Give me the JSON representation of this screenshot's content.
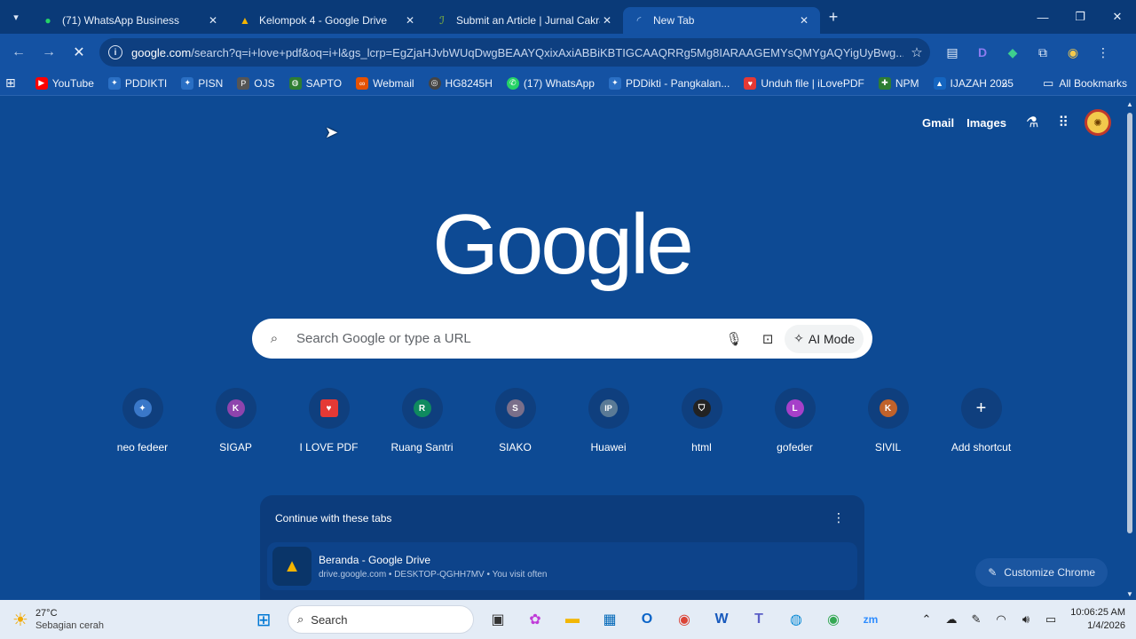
{
  "tabs": [
    {
      "title": "(71) WhatsApp Business",
      "icon": "whatsapp-icon",
      "active": false
    },
    {
      "title": "Kelompok 4 - Google Drive",
      "icon": "google-drive-icon",
      "active": false
    },
    {
      "title": "Submit an Article | Jurnal Cakra",
      "icon": "journal-icon",
      "active": false
    },
    {
      "title": "New Tab",
      "icon": "loading-icon",
      "active": true
    }
  ],
  "omnibox": {
    "url_domain": "google.com",
    "url_rest": "/search?q=i+love+pdf&oq=i+l&gs_lcrp=EgZjaHJvbWUqDwgBEAAYQxixAxiABBiKBTIGCAAQRRg5Mg8IARAAGEMYsQMYgAQYigUyBwg..."
  },
  "bookmarks": [
    {
      "label": "YouTube",
      "color": "#ff0000"
    },
    {
      "label": "PDDIKTI",
      "color": "#2a6fc4"
    },
    {
      "label": "PISN",
      "color": "#2a6fc4"
    },
    {
      "label": "OJS",
      "color": "#555555"
    },
    {
      "label": "SAPTO",
      "color": "#2e7d32"
    },
    {
      "label": "Webmail",
      "color": "#e65100"
    },
    {
      "label": "HG8245H",
      "color": "#444444"
    },
    {
      "label": "(17) WhatsApp",
      "color": "#25d366"
    },
    {
      "label": "PDDikti - Pangkalan...",
      "color": "#2a6fc4"
    },
    {
      "label": "Unduh file | iLovePDF",
      "color": "#e53935"
    },
    {
      "label": "NPM",
      "color": "#2e7d32"
    },
    {
      "label": "IJAZAH 2025",
      "color": "#1565c0"
    }
  ],
  "all_bookmarks": "All Bookmarks",
  "header_links": {
    "gmail": "Gmail",
    "images": "Images"
  },
  "logo": "Google",
  "search": {
    "placeholder": "Search Google or type a URL",
    "ai_mode": "AI Mode"
  },
  "shortcuts": [
    {
      "label": "neo fedeer",
      "letter": "",
      "color": "#3a78c9"
    },
    {
      "label": "SIGAP",
      "letter": "K",
      "color": "#8e44ad"
    },
    {
      "label": "I LOVE PDF",
      "letter": "",
      "color": "#e53935"
    },
    {
      "label": "Ruang Santri",
      "letter": "R",
      "color": "#0f8a5f"
    },
    {
      "label": "SIAKO",
      "letter": "S",
      "color": "#7a6f8a"
    },
    {
      "label": "Huawei",
      "letter": "IP",
      "color": "#5a7a96"
    },
    {
      "label": "html",
      "letter": "",
      "color": "#222222"
    },
    {
      "label": "gofeder",
      "letter": "L",
      "color": "#a640c9"
    },
    {
      "label": "SIVIL",
      "letter": "K",
      "color": "#c0622b"
    },
    {
      "label": "Add shortcut",
      "letter": "+",
      "color": "transparent"
    }
  ],
  "continue_tabs": {
    "heading": "Continue with these tabs",
    "items": [
      {
        "title": "Beranda - Google Drive",
        "meta": "drive.google.com • DESKTOP-QGHH7MV • You visit often"
      }
    ]
  },
  "customize": "Customize Chrome",
  "taskbar": {
    "weather_temp": "27°C",
    "weather_desc": "Sebagian cerah",
    "search_label": "Search",
    "time": "10:06:25 AM",
    "date": "1/4/2026"
  }
}
